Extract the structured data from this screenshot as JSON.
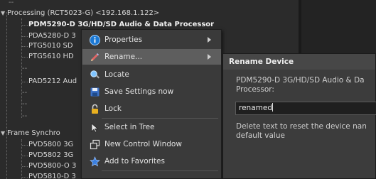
{
  "tree": {
    "top_dash": "--",
    "group1_label": "Processing (RCT5023-G) <192.168.1.122>",
    "group1_items": [
      {
        "label": "PDM5290-D 3G/HD/SD Audio & Data Processor",
        "bold": true
      },
      {
        "label": "PDA5280-D 3"
      },
      {
        "label": "PTG5010 SD"
      },
      {
        "label": "PTG5610 HD"
      },
      {
        "label": "--"
      },
      {
        "label": "PAD5212 Aud"
      },
      {
        "label": "--"
      },
      {
        "label": "--"
      },
      {
        "label": "--"
      }
    ],
    "group2_label": "Frame Synchro",
    "group2_items": [
      {
        "label": "PVD5800 3G"
      },
      {
        "label": "PVD5802 3G"
      },
      {
        "label": "PVD5800-O 3"
      },
      {
        "label": "PVD5810-D 3"
      }
    ]
  },
  "context_menu": {
    "items": [
      {
        "label": "Properties",
        "icon": "info-icon",
        "submenu": true
      },
      {
        "label": "Rename...",
        "icon": "pencil-icon",
        "submenu": true,
        "active": true
      },
      {
        "label": "Locate",
        "icon": "locate-icon"
      },
      {
        "label": "Save Settings now",
        "icon": "save-icon"
      },
      {
        "label": "Lock",
        "icon": "lock-icon"
      },
      {
        "label": "Select in Tree",
        "icon": "cursor-arrow-icon"
      },
      {
        "label": "New Control Window",
        "icon": "new-window-icon"
      },
      {
        "label": "Add to Favorites",
        "icon": "star-icon"
      }
    ]
  },
  "rename_dialog": {
    "title": "Rename Device",
    "description_line1": "PDM5290-D 3G/HD/SD Audio & Da",
    "description_line2": "Processor:",
    "input_value": "renamed",
    "hint_line1": "Delete text to reset the device nan",
    "hint_line2": "default value"
  },
  "colors": {
    "background": "#2b2b2b",
    "menu_bg": "#3a3a3a",
    "menu_active": "#5e5e5e",
    "info_blue": "#1a78d4",
    "lock_gold": "#e8b020",
    "star_blue": "#3a7fe0"
  }
}
